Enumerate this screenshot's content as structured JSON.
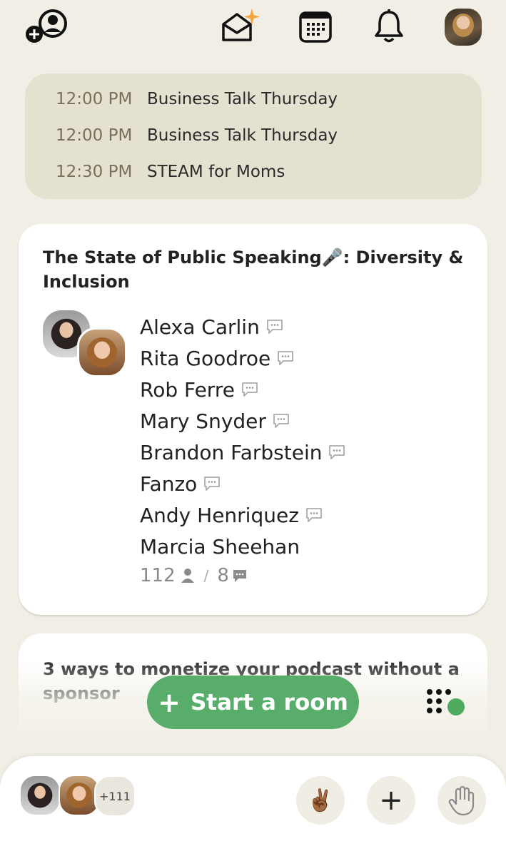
{
  "topbar": {
    "icons": [
      "add-user-icon",
      "invite-envelope-icon",
      "calendar-icon",
      "bell-icon"
    ],
    "profile_avatar": "profile-avatar"
  },
  "schedule": [
    {
      "time": "12:00 PM",
      "title": "Business Talk Thursday"
    },
    {
      "time": "12:00 PM",
      "title": "Business Talk Thursday"
    },
    {
      "time": "12:30 PM",
      "title": "STEAM for Moms"
    }
  ],
  "room": {
    "title": "The State of Public Speaking🎤: Diversity & Inclusion",
    "speakers": [
      "Alexa Carlin",
      "Rita Goodroe",
      "Rob Ferre",
      "Mary Snyder",
      "Brandon Farbstein",
      "Fanzo",
      "Andy Henriquez",
      "Marcia Sheehan"
    ],
    "listeners_count": "112",
    "separator": "/",
    "speakers_count": "8"
  },
  "room2": {
    "title": "3 ways to monetize your podcast without a sponsor"
  },
  "actions": {
    "start_room_label": "Start a room",
    "start_room_plus": "+"
  },
  "bottom_bar": {
    "extra_count": "+111",
    "peace_emoji": "✌🏾",
    "add_label": "+"
  },
  "colors": {
    "background": "#f1efe5",
    "schedule_bg": "#e4e1d1",
    "accent_green": "#58ad6b"
  }
}
